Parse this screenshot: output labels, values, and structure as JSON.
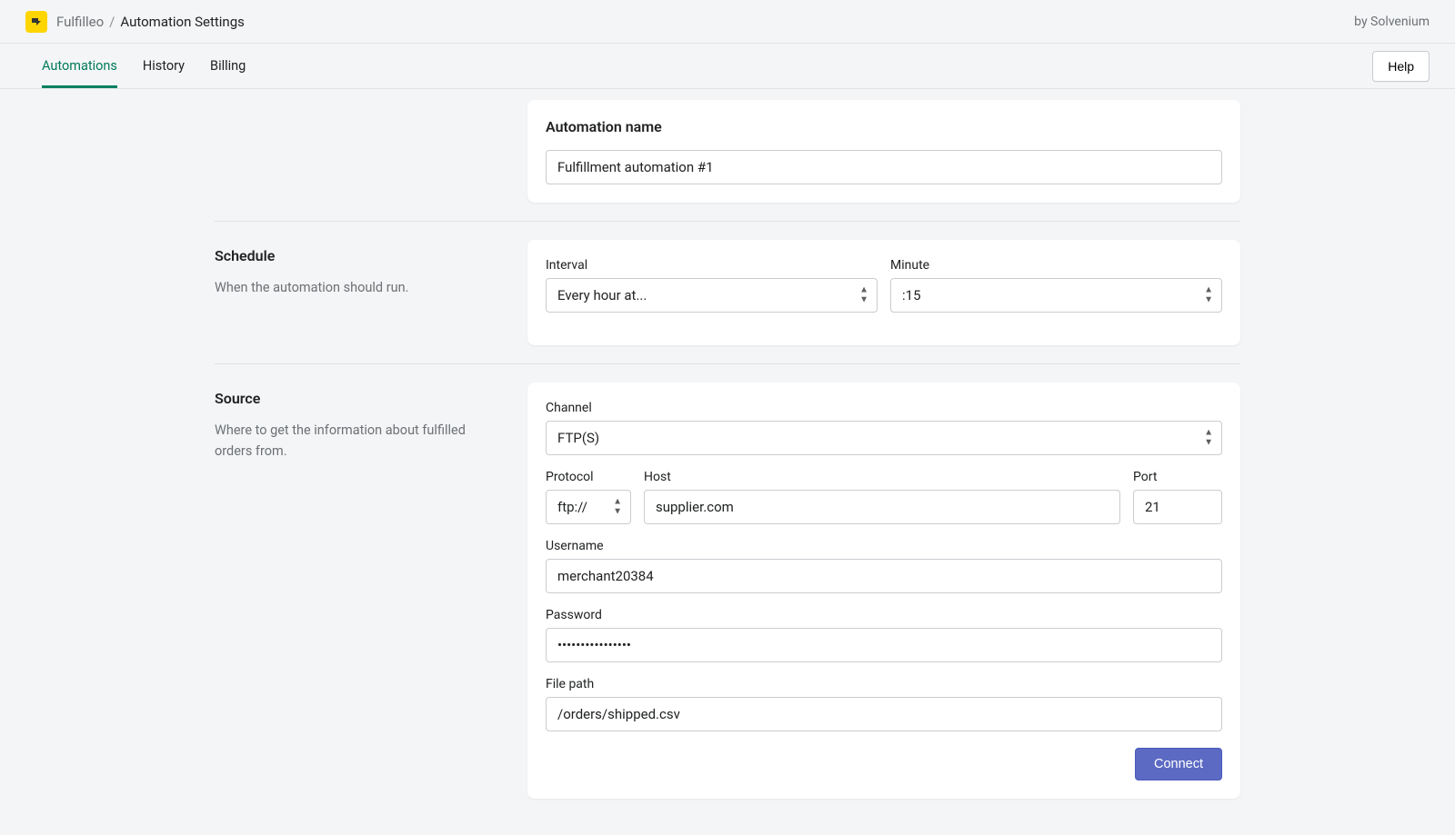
{
  "header": {
    "app_name": "Fulfilleo",
    "page_title": "Automation Settings",
    "vendor": "by Solvenium"
  },
  "tabs": {
    "items": [
      "Automations",
      "History",
      "Billing"
    ],
    "active_index": 0,
    "help_label": "Help"
  },
  "name_card": {
    "title": "Automation name",
    "value": "Fulfillment automation #1"
  },
  "schedule": {
    "title": "Schedule",
    "description": "When the automation should run.",
    "interval_label": "Interval",
    "interval_value": "Every hour at...",
    "minute_label": "Minute",
    "minute_value": ":15"
  },
  "source": {
    "title": "Source",
    "description": "Where to get the information about fulfilled orders from.",
    "channel_label": "Channel",
    "channel_value": "FTP(S)",
    "protocol_label": "Protocol",
    "protocol_value": "ftp://",
    "host_label": "Host",
    "host_value": "supplier.com",
    "port_label": "Port",
    "port_value": "21",
    "username_label": "Username",
    "username_value": "merchant20384",
    "password_label": "Password",
    "password_value": "••••••••••••••••",
    "filepath_label": "File path",
    "filepath_value": "/orders/shipped.csv",
    "connect_label": "Connect"
  }
}
